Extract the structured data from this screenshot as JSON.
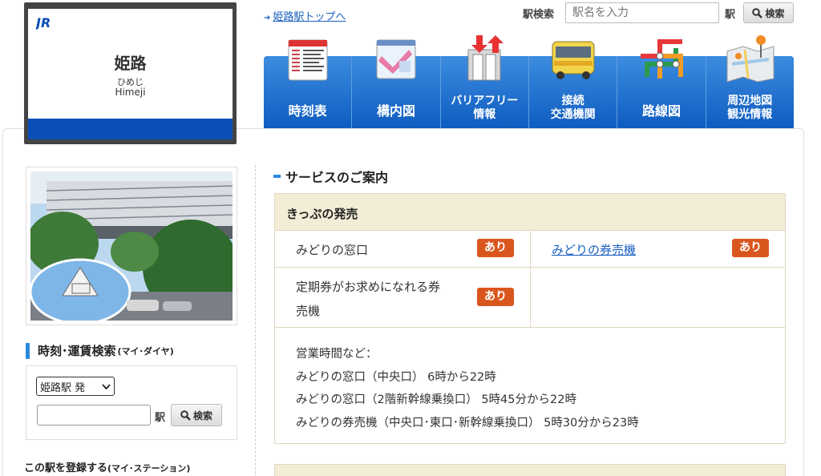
{
  "station": {
    "logo": "JR",
    "name": "姫路",
    "kana": "ひめじ",
    "romaji": "Himeji"
  },
  "header": {
    "top_link": "姫路駅トップへ",
    "search_label": "駅検索",
    "search_placeholder": "駅名を入力",
    "search_suffix": "駅",
    "search_button": "検索"
  },
  "nav": {
    "items": [
      {
        "label": "時刻表",
        "icon": "timetable-icon"
      },
      {
        "label": "構内図",
        "icon": "station-map-icon"
      },
      {
        "label_lines": [
          "バリアフリー",
          "情報"
        ],
        "icon": "barrier-free-icon"
      },
      {
        "label_lines": [
          "接続",
          "交通機関"
        ],
        "icon": "bus-icon"
      },
      {
        "label": "路線図",
        "icon": "route-map-icon"
      },
      {
        "label_lines": [
          "周辺地図",
          "観光情報"
        ],
        "icon": "area-map-icon"
      }
    ]
  },
  "left": {
    "search_title": "時刻･運賃検索",
    "search_title_sub": "(マイ･ダイヤ)",
    "departure_select": "姫路駅 発",
    "station_suffix": "駅",
    "search_button": "検索",
    "register_title": "この駅を登録する",
    "register_sub": "(マイ･ステーション)"
  },
  "services": {
    "section_title": "サービスのご案内",
    "table_title": "きっぷの発売",
    "rows": [
      {
        "label": "みどりの窓口",
        "badge": "あり"
      },
      {
        "label": "みどりの券売機",
        "badge": "あり",
        "link": true
      },
      {
        "label_lines": [
          "定期券がお求めになれる券",
          "売機"
        ],
        "badge": "あり"
      }
    ],
    "hours_lines": [
      "営業時間など：",
      "みどりの窓口（中央口） 6時から22時",
      "みどりの窓口（2階新幹線乗換口） 5時45分から22時",
      "みどりの券売機（中央口･東口･新幹線乗換口） 5時30分から23時"
    ]
  },
  "colors": {
    "nav_blue": "#1f6fd1",
    "badge_orange": "#d9571e",
    "table_header": "#f3ecd7",
    "sign_blue": "#0a4fb5",
    "link_blue": "#1a5fc0"
  }
}
